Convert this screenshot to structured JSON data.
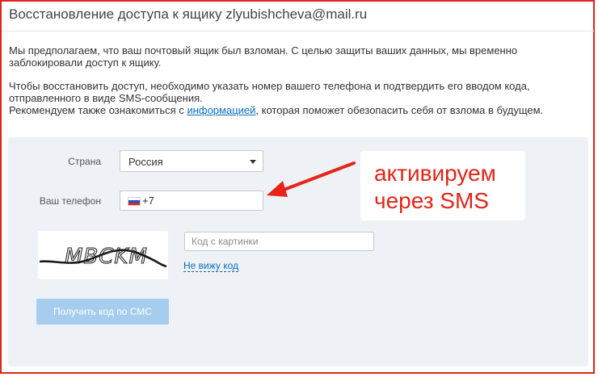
{
  "page": {
    "title": "Восстановление доступа к ящику zlyubishcheva@mail.ru",
    "paragraph1": "Мы предполагаем, что ваш почтовый ящик был взломан. С целью защиты ваших данных, мы временно заблокировали доступ к ящику.",
    "paragraph2_line1": "Чтобы восстановить доступ, необходимо указать номер вашего телефона и подтвердить его вводом кода,",
    "paragraph2_line2": "отправленного в виде SMS-сообщения.",
    "paragraph2_prefix": "Рекомендуем также ознакомиться с ",
    "info_link": "информацией",
    "paragraph2_suffix": ", которая поможет обезопасить себя от взлома в будущем."
  },
  "form": {
    "country_label": "Страна",
    "country_value": "Россия",
    "phone_label": "Ваш телефон",
    "phone_code": "+7",
    "captcha_text": "MBCKM",
    "captcha_placeholder": "Код с картинки",
    "no_see_link": "Не вижу код",
    "submit_label": "Получить код по СМС"
  },
  "annotation": {
    "line1": "активируем",
    "line2": "через SMS",
    "color": "#e62417"
  },
  "colors": {
    "frame_border": "#e2231a",
    "panel_bg": "#eef2f6",
    "link": "#0a6fc2",
    "button_bg": "#a6cdee"
  }
}
